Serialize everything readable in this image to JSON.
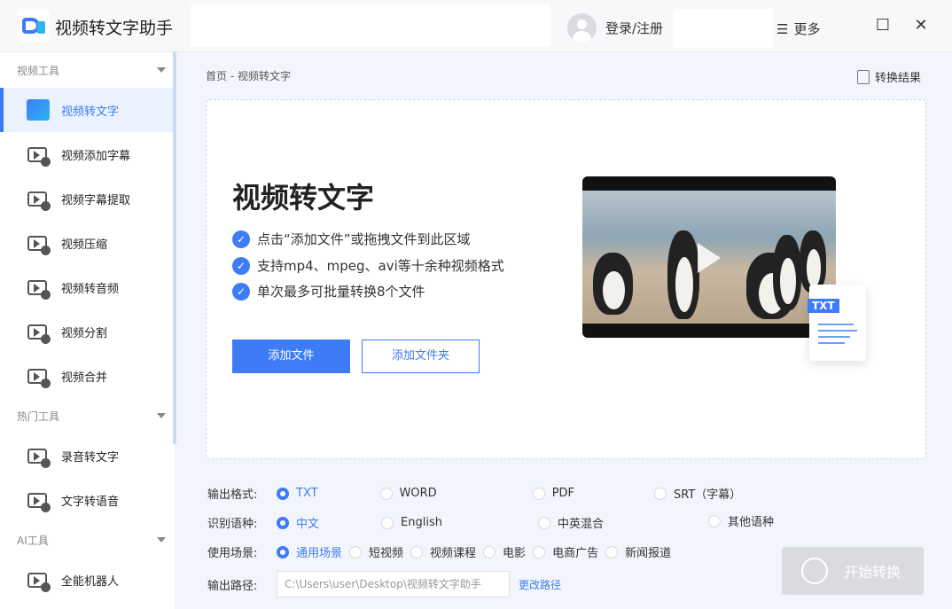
{
  "app": {
    "title": "视频转文字助手",
    "login": "登录/注册",
    "more": "更多"
  },
  "sidebar": {
    "groups": [
      {
        "label": "视频工具",
        "items": [
          {
            "label": "视频转文字",
            "active": true
          },
          {
            "label": "视频添加字幕"
          },
          {
            "label": "视频字幕提取"
          },
          {
            "label": "视频压缩"
          },
          {
            "label": "视频转音频"
          },
          {
            "label": "视频分割"
          },
          {
            "label": "视频合并"
          }
        ]
      },
      {
        "label": "热门工具",
        "items": [
          {
            "label": "录音转文字"
          },
          {
            "label": "文字转语音"
          }
        ]
      },
      {
        "label": "AI工具",
        "items": [
          {
            "label": "全能机器人"
          }
        ]
      }
    ]
  },
  "main": {
    "breadcrumb": "首页 - 视频转文字",
    "result_label": "转换结果",
    "card": {
      "title": "视频转文字",
      "features": [
        "点击“添加文件”或拖拽文件到此区域",
        "支持mp4、mpeg、avi等十余种视频格式",
        "单次最多可批量转换8个文件"
      ],
      "add_file": "添加文件",
      "add_folder": "添加文件夹",
      "doc_tag": "TXT"
    },
    "format": {
      "label": "输出格式:",
      "options": [
        "TXT",
        "WORD",
        "PDF",
        "SRT（字幕）"
      ],
      "selected": "TXT"
    },
    "language": {
      "label": "识别语种:",
      "options": [
        "中文",
        "English",
        "中英混合",
        "其他语种"
      ],
      "selected": "中文"
    },
    "scene": {
      "label": "使用场景:",
      "options": [
        "通用场景",
        "短视频",
        "视频课程",
        "电影",
        "电商广告",
        "新闻报道"
      ],
      "selected": "通用场景"
    },
    "output": {
      "label": "输出路径:",
      "path": "C:\\Users\\user\\Desktop\\视频转文字助手",
      "change": "更改路径"
    },
    "start": "开始转换"
  },
  "colors": {
    "accent": "#3d7cf6",
    "disabled": "#d9dbde"
  }
}
